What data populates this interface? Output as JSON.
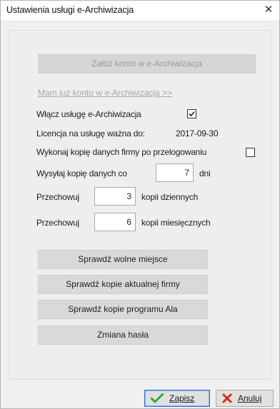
{
  "window": {
    "title": "Ustawienia usługi e-Archiwizacja",
    "close_glyph": "✕"
  },
  "buttons": {
    "create_account": "Załóż konto w e-Archiwizacja",
    "check_free_space": "Sprawdź wolne miejsce",
    "check_current_company_copies": "Sprawdź kopie aktualnej firmy",
    "check_program_copies": "Sprawdź kopie programu Ala",
    "change_password": "Zmiana hasła"
  },
  "link_existing_account": "Mam już konto w e-Archiwizacja >>",
  "service": {
    "enable_label": "Włącz usługę e-Archiwizacja",
    "enabled": true,
    "license_label": "Licencja na usługę ważna do:",
    "license_date": "2017-09-30",
    "backup_on_relogin_label": "Wykonaj kopię danych firmy po przelogowaniu",
    "backup_on_relogin": false
  },
  "schedule": {
    "send_every_label": "Wysyłaj kopię danych co",
    "send_every_value": "7",
    "send_every_unit": "dni",
    "keep_label_1": "Przechowuj",
    "keep_daily_value": "3",
    "keep_daily_unit": "kopii dziennych",
    "keep_label_2": "Przechowuj",
    "keep_monthly_value": "6",
    "keep_monthly_unit": "kopii miesięcznych"
  },
  "footer": {
    "save_label": "Zapisz",
    "cancel_label": "Anuluj"
  },
  "colors": {
    "accent_border": "#2a79d6",
    "save_icon": "#3aa53a",
    "cancel_icon": "#d9281e"
  },
  "icons": {
    "close": "close-icon",
    "check": "checkmark-icon",
    "save": "save-check-icon",
    "cancel": "cancel-x-icon"
  }
}
